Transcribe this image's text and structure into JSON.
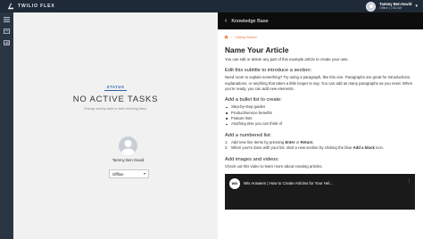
{
  "app": {
    "name": "TWILIO FLEX"
  },
  "user": {
    "name": "Tammy Ben-David",
    "status": "Offline | 3:52 AM"
  },
  "agent_panel": {
    "status_label": "STATUS",
    "no_tasks": "NO ACTIVE TASKS",
    "hint": "Change activity state to start receiving tasks.",
    "agent_name": "Tammy Ben David",
    "activity": "Offline"
  },
  "kb": {
    "header_title": "Knowledge Base",
    "breadcrumb": "Getting Started",
    "article_title": "Name Your Article",
    "intro": "You can edit or delete any part of this example article to create your own.",
    "section1": {
      "title": "Edit this subtitle to introduce a section:",
      "body": "Need room to explain something? Try using a paragraph, like this one. Paragraphs are great for introductions, explanations, or anything that takes a little longer to say. You can add as many paragraphs as you need. When you're ready, you can add new elements."
    },
    "section2": {
      "title": "Add a bullet list to create:",
      "items": [
        "Step-by-step guides",
        "Product/service benefits",
        "Feature lists",
        "Anything else you can think of"
      ]
    },
    "section3": {
      "title": "Add a numbered list:",
      "item1": {
        "num": "1.",
        "pre": "Add new line items by pressing ",
        "key1": "Enter",
        "mid": " or ",
        "key2": "Return",
        "post": "."
      },
      "item2": {
        "num": "2.",
        "pre": "When you're done with your list, start a new section by clicking the blue ",
        "key": "Add a block",
        "post": " icon."
      }
    },
    "section4": {
      "title": "Add images and videos:",
      "body": "Check out this video to learn more about creating articles."
    },
    "video": {
      "logo": "WiX",
      "title": "Wix Answers | How to Create Articles for Your Hel..."
    }
  },
  "colors": {
    "topbar": "#1f2a38",
    "sidenav": "#2a3543",
    "status_blue": "#2b5fa9",
    "crumb": "#e8793a"
  }
}
